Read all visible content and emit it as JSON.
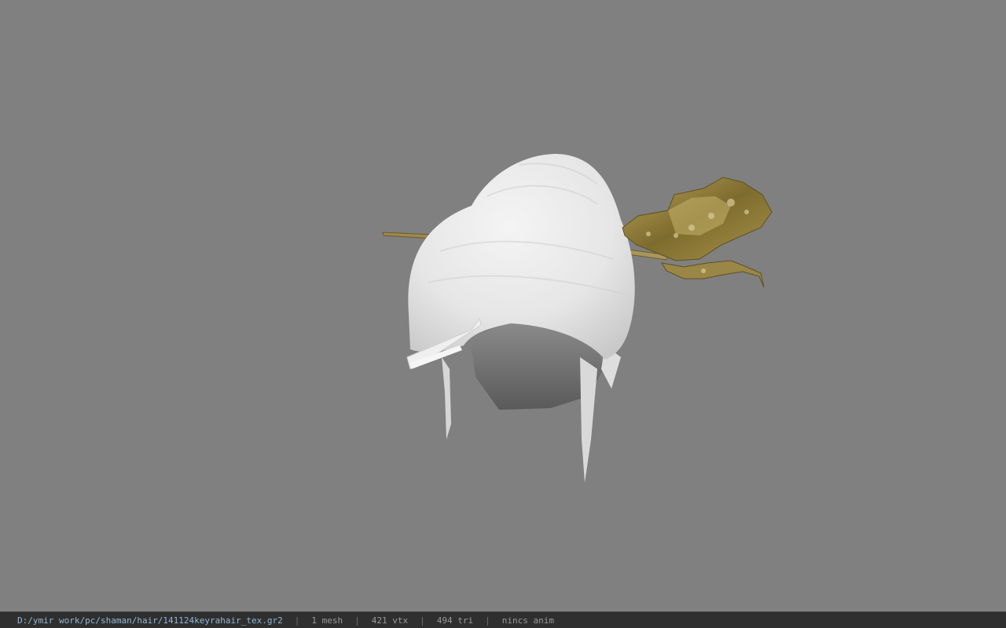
{
  "viewer": {
    "background_color": "#808080",
    "model": {
      "hair_color": "#e8e8e8",
      "ornament_color": "#8a7a3e"
    }
  },
  "statusbar": {
    "file_path": "D:/ymir work/pc/shaman/hair/141124keyrahair_tex.gr2",
    "separator": "|",
    "mesh_count": "1 mesh",
    "vertex_count": "421 vtx",
    "triangle_count": "494 tri",
    "anim_status": "nincs anim"
  }
}
